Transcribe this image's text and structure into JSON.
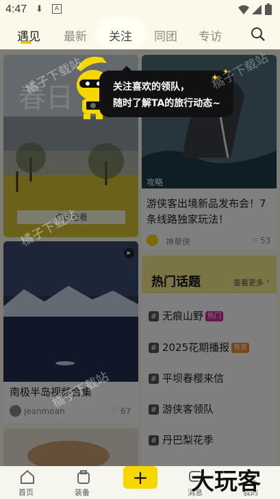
{
  "status_bar": {
    "time": "4:47",
    "icons": [
      "download-icon",
      "a-icon",
      "wifi-icon",
      "signal-icon",
      "battery-icon"
    ]
  },
  "top_tabs": [
    {
      "label": "遇见",
      "active": true
    },
    {
      "label": "最新"
    },
    {
      "label": "关注",
      "highlighted": true
    },
    {
      "label": "同团"
    },
    {
      "label": "专访"
    }
  ],
  "search_icon": "search-icon",
  "guide": {
    "line1": "关注喜欢的领队，",
    "line2": "随时了解TA的旅行动态~"
  },
  "cards": {
    "spring": {
      "image_title": "春日",
      "button": "点击查看"
    },
    "whale": {
      "badge": "攻略",
      "title": "游侠客出境新品发布会！7条线路独家玩法！",
      "author": "神草侠",
      "likes": "53"
    },
    "antarctic": {
      "title": "南极半岛视频合集",
      "author": "jeanmean",
      "likes": "67"
    }
  },
  "hot_topics": {
    "title": "热门话题",
    "more": "查看更多",
    "items": [
      {
        "label": "无痕山野",
        "tag": "热门",
        "tag_color": "#d02aa0"
      },
      {
        "label": "2025花期播报",
        "tag": "有奖",
        "tag_color": "#f08a28"
      },
      {
        "label": "平坝春樱来信",
        "tag": ""
      },
      {
        "label": "游侠客领队",
        "tag": ""
      },
      {
        "label": "丹巴梨花季",
        "tag": ""
      }
    ]
  },
  "bottom_nav": [
    {
      "label": "首页",
      "icon": "home-icon"
    },
    {
      "label": "装备",
      "icon": "gear-bag-icon"
    },
    {
      "label": "",
      "icon": "plus-icon"
    },
    {
      "label": "消息",
      "icon": "message-icon"
    },
    {
      "label": "我的",
      "icon": "profile-icon"
    }
  ],
  "watermarks": {
    "site": "橘子下载站",
    "logo": "大玩客"
  },
  "colors": {
    "accent": "#f5d800",
    "background": "#fbf9ea"
  }
}
